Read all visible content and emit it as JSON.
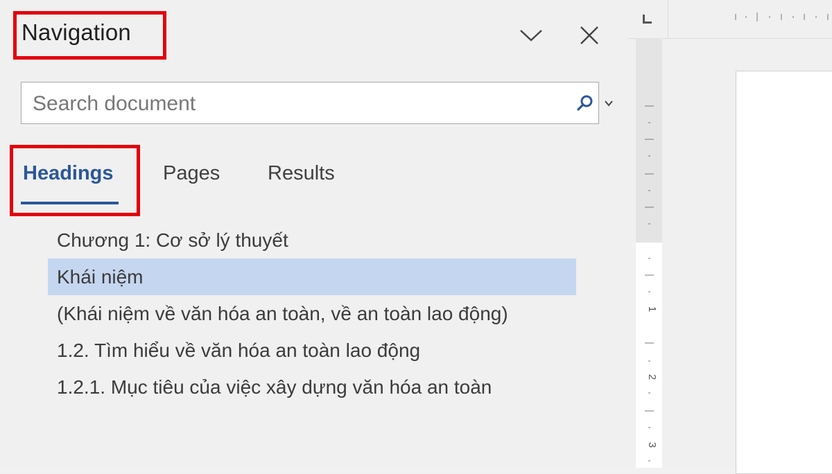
{
  "navigation": {
    "title": "Navigation",
    "options_icon": "chevron-down-icon",
    "close_icon": "close-icon"
  },
  "search": {
    "placeholder": "Search document",
    "value": "",
    "icon": "search-icon",
    "dropdown_icon": "chevron-down-icon"
  },
  "tabs": [
    {
      "label": "Headings",
      "active": true
    },
    {
      "label": "Pages",
      "active": false
    },
    {
      "label": "Results",
      "active": false
    }
  ],
  "headings": [
    {
      "label": "Chương 1: Cơ sở lý thuyết",
      "selected": false
    },
    {
      "label": "Khái niệm",
      "selected": true
    },
    {
      "label": "(Khái niệm về văn hóa an toàn, về an toàn lao động)",
      "selected": false
    },
    {
      "label": "1.2. Tìm hiểu về văn hóa an toàn lao động",
      "selected": false
    },
    {
      "label": "1.2.1. Mục tiêu của việc xây dựng văn hóa an toàn",
      "selected": false
    }
  ],
  "ruler": {
    "vertical_numbers": [
      "1",
      "2",
      "3"
    ]
  },
  "colors": {
    "accent": "#2b579a",
    "selection": "#c5d6f0",
    "highlight_box": "#e3000b",
    "pane_background": "#f0f0f0"
  }
}
